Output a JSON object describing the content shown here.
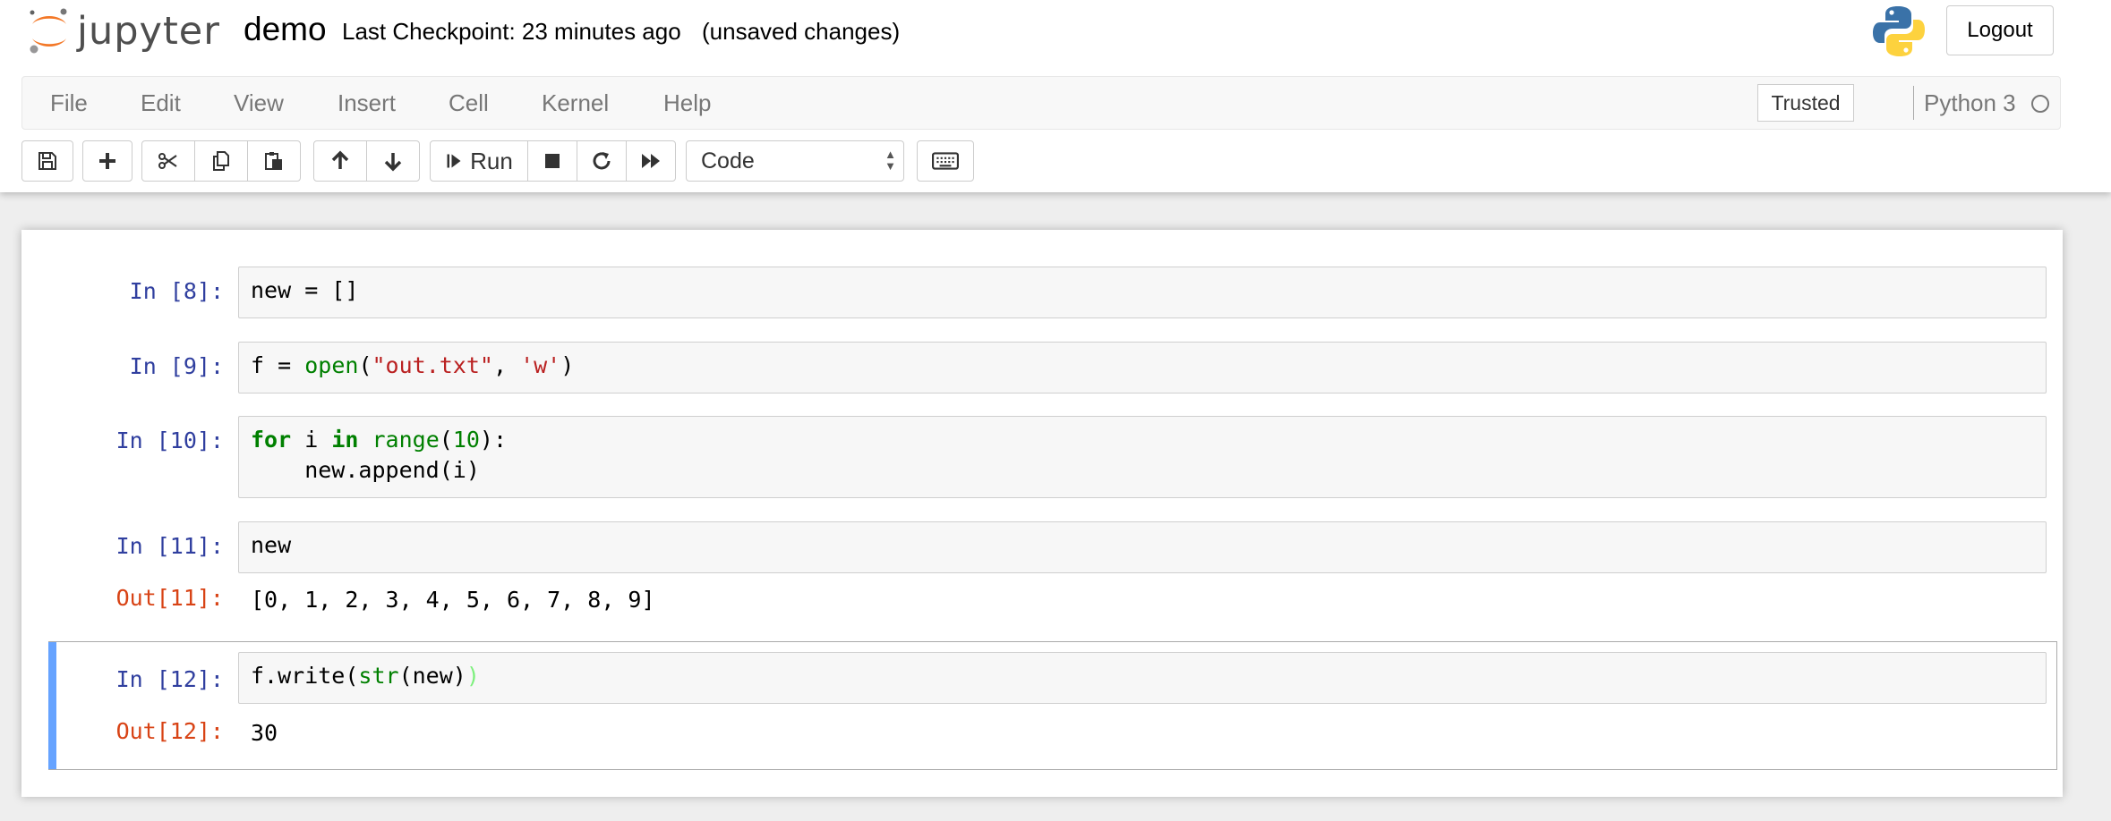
{
  "header": {
    "logo_text": "jupyter",
    "notebook_name": "demo",
    "checkpoint": "Last Checkpoint: 23 minutes ago",
    "autosave_status": "(unsaved changes)",
    "logout_label": "Logout"
  },
  "menu": {
    "items": [
      "File",
      "Edit",
      "View",
      "Insert",
      "Cell",
      "Kernel",
      "Help"
    ],
    "trusted_label": "Trusted",
    "kernel_name": "Python 3"
  },
  "toolbar": {
    "run_label": "Run",
    "cell_type": "Code"
  },
  "cells": [
    {
      "in_prompt": "In [8]:",
      "code": "new = []"
    },
    {
      "in_prompt": "In [9]:",
      "code": "f = open(\"out.txt\", 'w')"
    },
    {
      "in_prompt": "In [10]:",
      "code": "for i in range(10):\n    new.append(i)"
    },
    {
      "in_prompt": "In [11]:",
      "code": "new",
      "out_prompt": "Out[11]:",
      "output": "[0, 1, 2, 3, 4, 5, 6, 7, 8, 9]"
    },
    {
      "in_prompt": "In [12]:",
      "code": "f.write(str(new))",
      "out_prompt": "Out[12]:",
      "output": "30",
      "selected": true
    }
  ],
  "colors": {
    "in_prompt": "#303f9f",
    "out_prompt": "#d84315",
    "selected_bar": "#66a3ff",
    "keyword": "#008000",
    "string": "#ba2121"
  }
}
